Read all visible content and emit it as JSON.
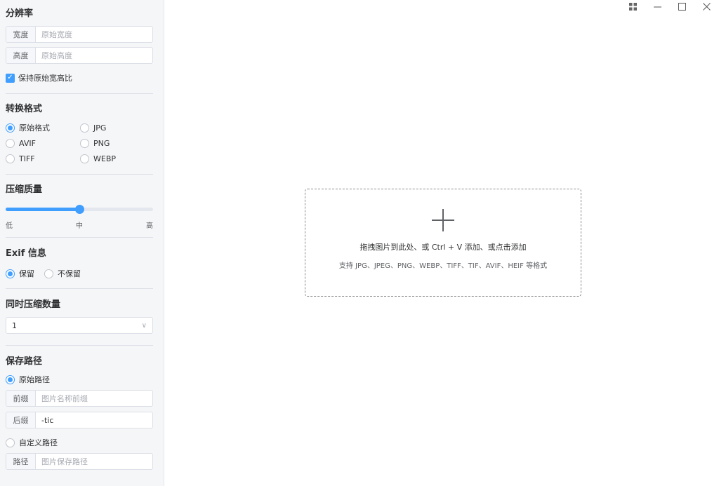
{
  "resolution": {
    "title": "分辨率",
    "width_label": "宽度",
    "width_placeholder": "原始宽度",
    "height_label": "高度",
    "height_placeholder": "原始高度",
    "keep_ratio_label": "保持原始宽高比",
    "keep_ratio_checked": true
  },
  "format": {
    "title": "转换格式",
    "options": [
      "原始格式",
      "JPG",
      "AVIF",
      "PNG",
      "TIFF",
      "WEBP"
    ],
    "selected": "原始格式"
  },
  "quality": {
    "title": "压缩质量",
    "value_fraction": 0.5,
    "labels": [
      "低",
      "中",
      "高"
    ]
  },
  "exif": {
    "title": "Exif 信息",
    "options": [
      "保留",
      "不保留"
    ],
    "selected": "保留"
  },
  "concurrency": {
    "title": "同时压缩数量",
    "value": "1"
  },
  "save_path": {
    "title": "保存路径",
    "original_label": "原始路径",
    "prefix_label": "前缀",
    "prefix_placeholder": "图片名称前缀",
    "suffix_label": "后缀",
    "suffix_value": "-tic",
    "custom_label": "自定义路径",
    "path_label": "路径",
    "path_placeholder": "图片保存路径",
    "selected": "原始路径"
  },
  "window": {
    "icons": [
      "grid-icon",
      "minimize-icon",
      "maximize-icon",
      "close-icon"
    ]
  },
  "dropzone": {
    "main_text": "拖拽图片到此处、或 Ctrl + V 添加、或点击添加",
    "sub_text": "支持 JPG、JPEG、PNG、WEBP、TIFF、TIF、AVIF、HEIF 等格式"
  },
  "colors": {
    "accent": "#409eff",
    "sidebar_bg": "#f5f6f8"
  }
}
